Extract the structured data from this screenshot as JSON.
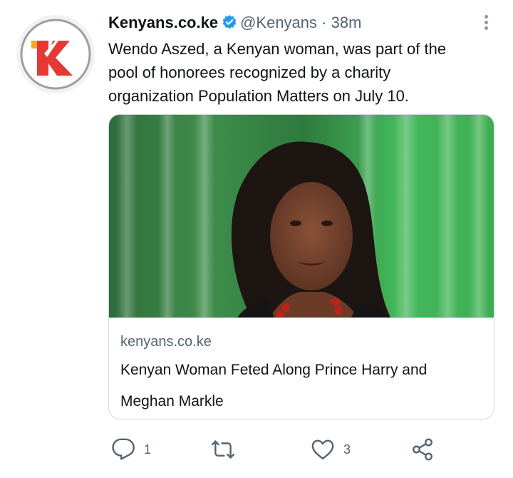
{
  "tweet": {
    "display_name": "Kenyans.co.ke",
    "handle": "@Kenyans",
    "separator": "·",
    "time": "38m",
    "text": "Wendo Aszed, a Kenyan woman, was part of the pool of honorees recognized by a charity organization Population Matters on July 10."
  },
  "card": {
    "domain": "kenyans.co.ke",
    "title": "Kenyan Woman Feted Along Prince Harry and Meghan Markle"
  },
  "actions": {
    "reply_count": "1",
    "retweet_count": "",
    "like_count": "3"
  },
  "icons": {
    "avatar_logo": "kenyans-k-logo",
    "verified": "verified-badge-icon",
    "more": "more-vertical-icon",
    "reply": "reply-icon",
    "retweet": "retweet-icon",
    "like": "heart-icon",
    "share": "share-icon"
  },
  "colors": {
    "brand_red": "#e53935",
    "brand_orange": "#f5a623",
    "verified_blue": "#1d9bf0",
    "muted_text": "#536471"
  }
}
